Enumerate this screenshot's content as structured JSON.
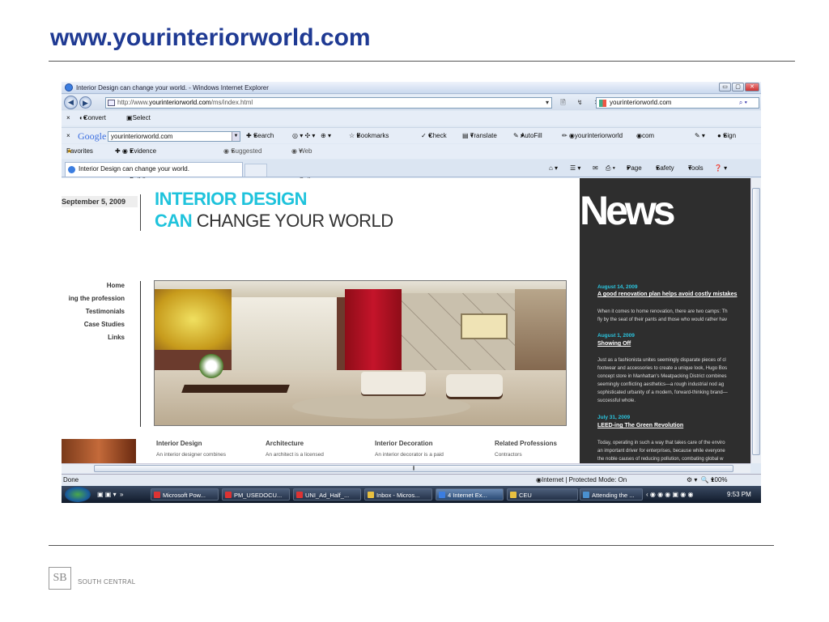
{
  "slide": {
    "title": "www.yourinteriorworld.com",
    "footer_logo": "SB",
    "footer_text": "SOUTH CENTRAL"
  },
  "window": {
    "title": "Interior Design can change your world. - Windows Internet Explorer",
    "buttons": [
      "▭",
      "▢",
      "✕"
    ]
  },
  "address": {
    "prefix": "http://www.",
    "domain": "yourinteriorworld.com",
    "path": "/ms/index.html",
    "icons": "▾ 🗎 ↯ ✕",
    "search_value": "yourinteriorworld.com",
    "search_icon": "⌕ ▾"
  },
  "cmdbar": {
    "close": "×",
    "convert": "Convert",
    "convert_dd": "▾",
    "select": "Select"
  },
  "google_bar": {
    "close": "×",
    "logo": "Google",
    "input": "yourinteriorworld.com",
    "search": "Search",
    "bookmarks": "Bookmarks",
    "check": "Check",
    "translate": "Translate",
    "autofill": "AutoFill",
    "link1": "yourinteriorworld",
    "link2": "com",
    "signin": "Sign In"
  },
  "favbar": {
    "favorites": "Favorites",
    "fav1": "Evidence Based Building ...",
    "fav2": "Suggested Sites",
    "fav3": "Web Slice Gallery"
  },
  "tabs": {
    "active": "Interior Design can change your world.",
    "page": "Page",
    "safety": "Safety",
    "tools": "Tools"
  },
  "site": {
    "date": "September 5, 2009",
    "hero_line1": "INTERIOR DESIGN",
    "hero_can": "CAN",
    "hero_line2": " CHANGE YOUR WORLD",
    "nav": [
      "Home",
      "ing the profession",
      "Testimonials",
      "Case Studies",
      "Links"
    ],
    "columns": [
      {
        "heading": "Interior Design",
        "body": "An interior designer combines"
      },
      {
        "heading": "Architecture",
        "body": "An architect is a licensed"
      },
      {
        "heading": "Interior Decoration",
        "body": "An interior decorator is a paid"
      },
      {
        "heading": "Related Professions",
        "body": "Contractors"
      }
    ]
  },
  "news": {
    "logo": "News",
    "items": [
      {
        "date": "August 14, 2009",
        "headline": "A good renovation plan helps avoid costly mistakes",
        "body": [
          "When it comes to home renovation, there are two camps: Th",
          "fly by the seat of their pants and those who would rather hav"
        ]
      },
      {
        "date": "August 1, 2009",
        "headline": "Showing Off",
        "body": [
          "Just as a fashionista unites seemingly disparate pieces of cl",
          "footwear and accessories to create a unique look, Hugo Bos",
          "concept store in Manhattan's Meatpacking District combines",
          "seemingly conflicting aesthetics—a rough industrial nod ag",
          "sophisticated urbanity of a modern, forward-thinking brand—",
          "successful whole."
        ]
      },
      {
        "date": "July 31, 2009",
        "headline": "LEED-ing The Green Revolution",
        "body": [
          "Today, operating in such a way that takes care of the enviro",
          "an important driver for enterprises, because while everyone",
          "the noble causes of reducing pollution, combating global w"
        ]
      }
    ]
  },
  "status": {
    "left": "Done",
    "zone": "Internet | Protected Mode: On",
    "zoom": "100%"
  },
  "taskbar": {
    "items": [
      "Microsoft Pow...",
      "PM_USEDOCU...",
      "UNI_Ad_Half_...",
      "Inbox - Micros...",
      "4 Internet Ex...",
      "CEU",
      "Attending the ..."
    ],
    "time": "9:53 PM"
  }
}
